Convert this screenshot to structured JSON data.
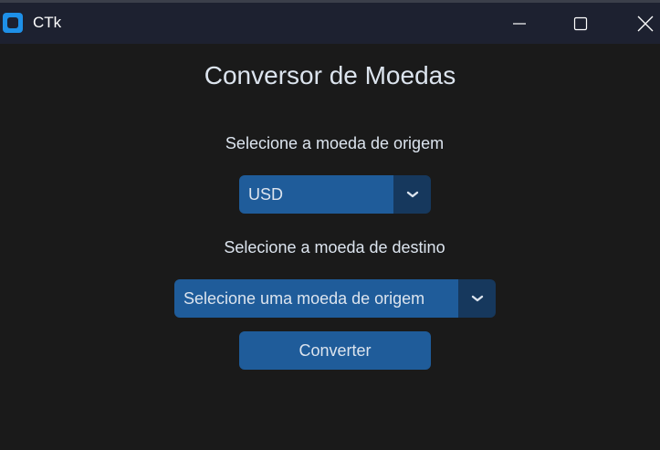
{
  "window": {
    "title": "CTk",
    "icon": "ctk-app-icon",
    "controls": {
      "minimize_icon": "minimize-icon",
      "maximize_icon": "maximize-icon",
      "close_icon": "close-icon"
    }
  },
  "main": {
    "heading": "Conversor de Moedas",
    "origin_label": "Selecione a moeda de origem",
    "origin_select": {
      "value": "USD",
      "arrow_icon": "chevron-down-icon"
    },
    "destination_label": "Selecione a moeda de destino",
    "destination_select": {
      "value": "Selecione uma moeda de origem",
      "arrow_icon": "chevron-down-icon"
    },
    "convert_button": "Converter"
  },
  "colors": {
    "background": "#1a1a1a",
    "titlebar": "#1d2130",
    "accent": "#1f5c9a",
    "accent_dark": "#16385d",
    "text": "#dce4ee",
    "app_icon": "#1e90e8"
  }
}
